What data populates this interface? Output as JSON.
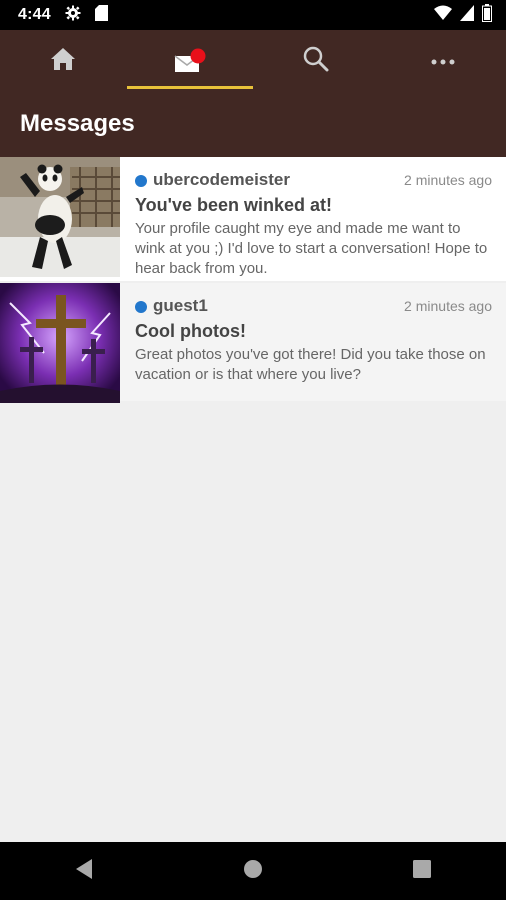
{
  "status_bar": {
    "time": "4:44",
    "icons": [
      "gear-icon",
      "sd-card-icon",
      "wifi-icon",
      "signal-icon",
      "battery-icon"
    ]
  },
  "tabs": [
    {
      "name": "home",
      "icon": "home-icon",
      "selected": false
    },
    {
      "name": "messages",
      "icon": "mail-icon",
      "selected": true,
      "badge": true
    },
    {
      "name": "search",
      "icon": "search-icon",
      "selected": false
    },
    {
      "name": "more",
      "icon": "more-icon",
      "selected": false
    }
  ],
  "page_title": "Messages",
  "messages": [
    {
      "sender": "ubercodemeister",
      "time": "2 minutes ago",
      "subject": "You've been winked at!",
      "preview": "Your profile caught my eye and made me want to wink at you ;) I'd love to start a conversation! Hope to hear back from you.",
      "unread": true,
      "thumbnail": "panda-photo"
    },
    {
      "sender": "guest1",
      "time": "2 minutes ago",
      "subject": "Cool photos!",
      "preview": "Great photos you've got there! Did you take those on vacation or is that where you live?",
      "unread": true,
      "thumbnail": "crosses-lightning-photo"
    }
  ],
  "colors": {
    "header_bg": "#412823",
    "tab_indicator": "#e8c23a",
    "unread_dot": "#2277cc",
    "badge": "#e8101a"
  },
  "nav_bar": {
    "buttons": [
      "back-icon",
      "home-circle-icon",
      "recents-icon"
    ]
  }
}
